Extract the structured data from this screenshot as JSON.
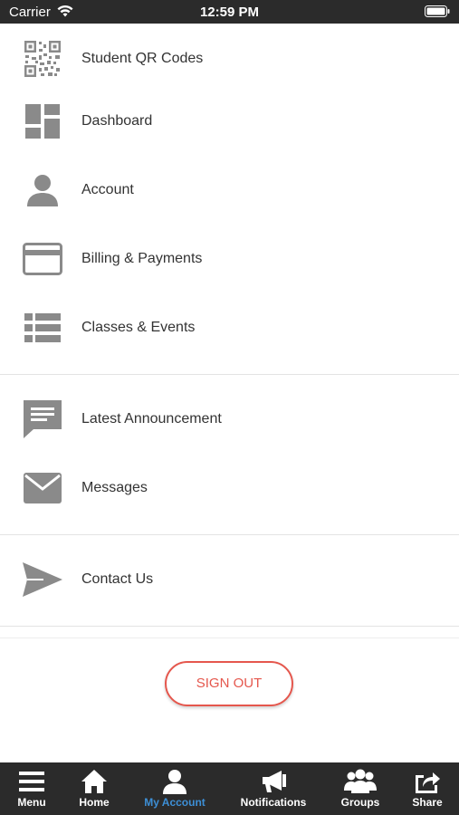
{
  "status_bar": {
    "carrier": "Carrier",
    "time": "12:59 PM"
  },
  "menu": {
    "items": [
      {
        "label": "Student QR Codes",
        "icon": "qr-code-icon"
      },
      {
        "label": "Dashboard",
        "icon": "dashboard-icon"
      },
      {
        "label": "Account",
        "icon": "person-icon"
      },
      {
        "label": "Billing & Payments",
        "icon": "credit-card-icon"
      },
      {
        "label": "Classes & Events",
        "icon": "list-icon"
      },
      {
        "label": "Latest Announcement",
        "icon": "speech-bubble-icon"
      },
      {
        "label": "Messages",
        "icon": "envelope-icon"
      },
      {
        "label": "Contact Us",
        "icon": "paper-plane-icon"
      }
    ]
  },
  "sign_out": {
    "label": "SIGN OUT"
  },
  "tabbar": {
    "tabs": [
      {
        "label": "Menu",
        "icon": "hamburger-icon"
      },
      {
        "label": "Home",
        "icon": "home-icon"
      },
      {
        "label": "My Account",
        "icon": "person-icon",
        "active": true
      },
      {
        "label": "Notifications",
        "icon": "megaphone-icon"
      },
      {
        "label": "Groups",
        "icon": "group-icon"
      },
      {
        "label": "Share",
        "icon": "share-icon"
      }
    ]
  },
  "colors": {
    "accent": "#e5574d",
    "active_tab": "#3d8fd6",
    "bar": "#2b2b2b",
    "icon": "#8a8a8a"
  }
}
